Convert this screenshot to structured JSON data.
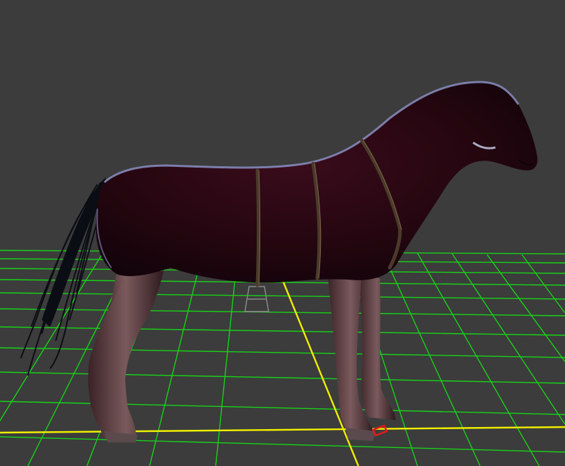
{
  "scene": {
    "background_color": "#3c3c3c",
    "grid_color": "#17d417",
    "axis_color": "#f0f000",
    "origin_marker_color": "#e21a1a",
    "subject": "horse-model",
    "horse_coat_color": "#2a0914",
    "horse_leg_color": "#5a3a3e",
    "mane_tail_color": "#0b0d14",
    "strap_color": "#4a3a2a"
  }
}
